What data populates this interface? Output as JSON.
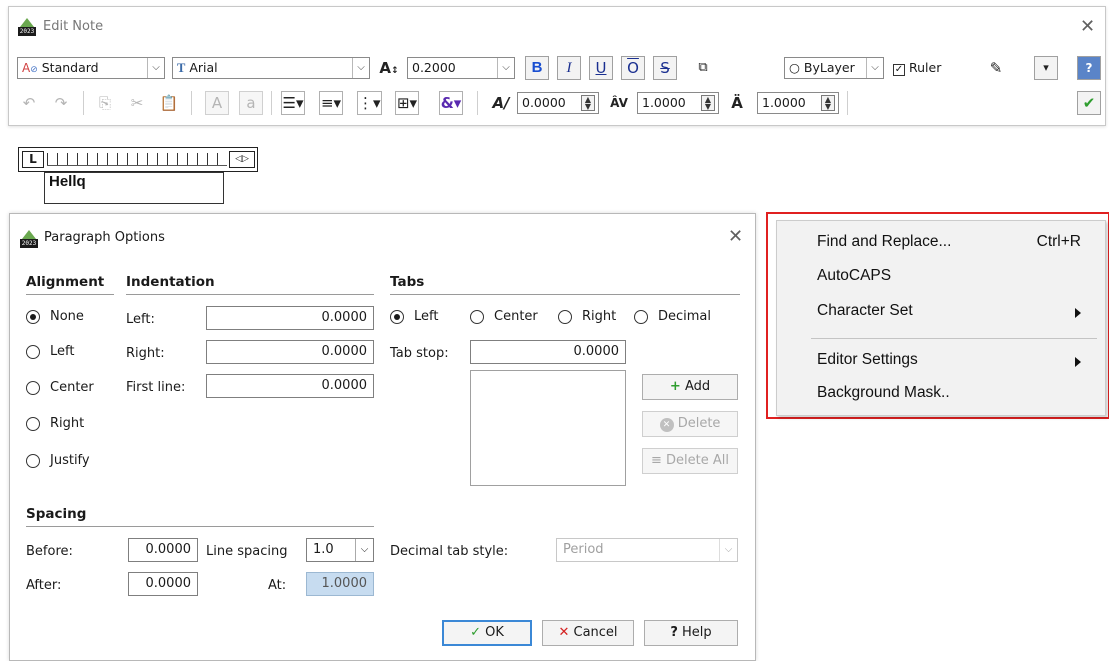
{
  "edit_note": {
    "title": "Edit Note",
    "style_combo": "Standard",
    "font_combo": "Arial",
    "height_value": "0.2000",
    "color_combo": "ByLayer",
    "ruler_label": "Ruler",
    "oblique_value": "0.0000",
    "tracking_value": "1.0000",
    "width_factor_value": "1.0000"
  },
  "editor": {
    "text": "Hellq"
  },
  "paragraph_dialog": {
    "title": "Paragraph Options",
    "alignment": {
      "header": "Alignment",
      "options": [
        "None",
        "Left",
        "Center",
        "Right",
        "Justify"
      ],
      "selected": "None"
    },
    "indentation": {
      "header": "Indentation",
      "left_label": "Left:",
      "left_value": "0.0000",
      "right_label": "Right:",
      "right_value": "0.0000",
      "first_line_label": "First line:",
      "first_line_value": "0.0000"
    },
    "tabs": {
      "header": "Tabs",
      "types": [
        "Left",
        "Center",
        "Right",
        "Decimal"
      ],
      "selected": "Left",
      "tab_stop_label": "Tab stop:",
      "tab_stop_value": "0.0000",
      "add_label": "Add",
      "delete_label": "Delete",
      "delete_all_label": "Delete All"
    },
    "spacing": {
      "header": "Spacing",
      "before_label": "Before:",
      "before_value": "0.0000",
      "after_label": "After:",
      "after_value": "0.0000",
      "line_spacing_label": "Line spacing",
      "line_spacing_value": "1.0",
      "at_label": "At:",
      "at_value": "1.0000"
    },
    "decimal_tab_style_label": "Decimal tab style:",
    "decimal_tab_style_value": "Period",
    "ok_label": "OK",
    "cancel_label": "Cancel",
    "help_label": "Help"
  },
  "context_menu": {
    "items": [
      {
        "label": "Find and Replace...",
        "shortcut": "Ctrl+R"
      },
      {
        "label": "AutoCAPS"
      },
      {
        "label": "Character Set",
        "submenu": true
      },
      {
        "label": "Editor Settings",
        "submenu": true
      },
      {
        "label": "Background Mask.."
      }
    ],
    "highlight_color": "#e02020"
  },
  "colors": {
    "bold_blue": "#1a4fd1",
    "accept_green": "#2e9d2e",
    "cancel_red": "#d42020",
    "add_green": "#2e9d2e"
  }
}
